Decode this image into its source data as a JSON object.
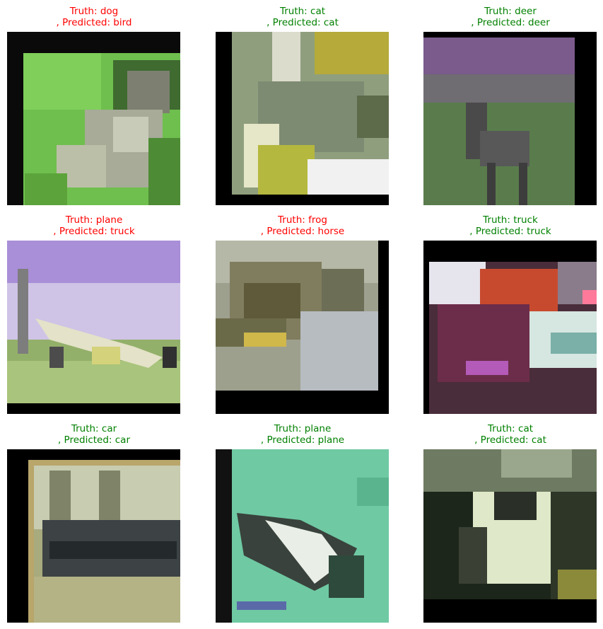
{
  "colors": {
    "correct": "#008000",
    "incorrect": "#ff0000"
  },
  "grid": [
    {
      "truth_label": "Truth: dog",
      "pred_label": ", Predicted: bird",
      "correct": false,
      "image": "dog"
    },
    {
      "truth_label": "Truth: cat",
      "pred_label": ", Predicted: cat",
      "correct": true,
      "image": "cat"
    },
    {
      "truth_label": "Truth: deer",
      "pred_label": ", Predicted: deer",
      "correct": true,
      "image": "deer"
    },
    {
      "truth_label": "Truth: plane",
      "pred_label": ", Predicted: truck",
      "correct": false,
      "image": "plane"
    },
    {
      "truth_label": "Truth: frog",
      "pred_label": ", Predicted: horse",
      "correct": false,
      "image": "frog"
    },
    {
      "truth_label": "Truth: truck",
      "pred_label": ", Predicted: truck",
      "correct": true,
      "image": "truck"
    },
    {
      "truth_label": "Truth: car",
      "pred_label": ", Predicted: car",
      "correct": true,
      "image": "car"
    },
    {
      "truth_label": "Truth: plane",
      "pred_label": ", Predicted: plane",
      "correct": true,
      "image": "plane"
    },
    {
      "truth_label": "Truth: cat",
      "pred_label": ", Predicted: cat",
      "correct": true,
      "image": "cat"
    }
  ]
}
